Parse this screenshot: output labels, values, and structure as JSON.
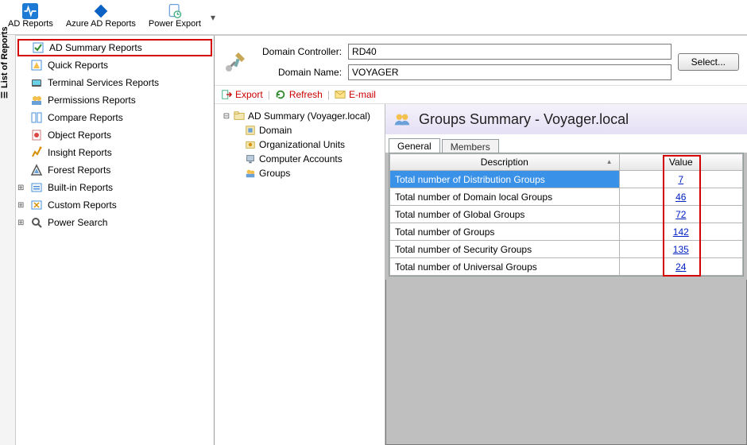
{
  "toolbar": {
    "ad_reports": "AD Reports",
    "azure_reports": "Azure AD Reports",
    "power_export": "Power Export"
  },
  "sidebar_title": "List of Reports",
  "sidebar": [
    {
      "label": "AD Summary Reports",
      "highlight": true
    },
    {
      "label": "Quick Reports"
    },
    {
      "label": "Terminal Services Reports"
    },
    {
      "label": "Permissions Reports"
    },
    {
      "label": "Compare Reports"
    },
    {
      "label": "Object Reports"
    },
    {
      "label": "Insight Reports"
    },
    {
      "label": "Forest Reports"
    },
    {
      "label": "Built-in Reports",
      "expandable": true
    },
    {
      "label": "Custom Reports",
      "expandable": true
    },
    {
      "label": "Power Search",
      "expandable": true
    }
  ],
  "props": {
    "dc_label": "Domain Controller:",
    "dc_value": "RD40",
    "dn_label": "Domain Name:",
    "dn_value": "VOYAGER",
    "select_btn": "Select..."
  },
  "actions": {
    "export": "Export",
    "refresh": "Refresh",
    "email": "E-mail"
  },
  "tree": {
    "root": "AD Summary (Voyager.local)",
    "children": [
      "Domain",
      "Organizational Units",
      "Computer Accounts",
      "Groups"
    ]
  },
  "summary": {
    "title": "Groups Summary - Voyager.local",
    "tabs": {
      "general": "General",
      "members": "Members"
    },
    "columns": {
      "desc": "Description",
      "value": "Value"
    },
    "rows": [
      {
        "desc": "Total number of Distribution Groups",
        "value": "7",
        "selected": true
      },
      {
        "desc": "Total number of Domain local Groups",
        "value": "46"
      },
      {
        "desc": "Total number of Global Groups",
        "value": "72"
      },
      {
        "desc": "Total number of Groups",
        "value": "142"
      },
      {
        "desc": "Total number of Security Groups",
        "value": "135"
      },
      {
        "desc": "Total number of Universal Groups",
        "value": "24"
      }
    ]
  }
}
